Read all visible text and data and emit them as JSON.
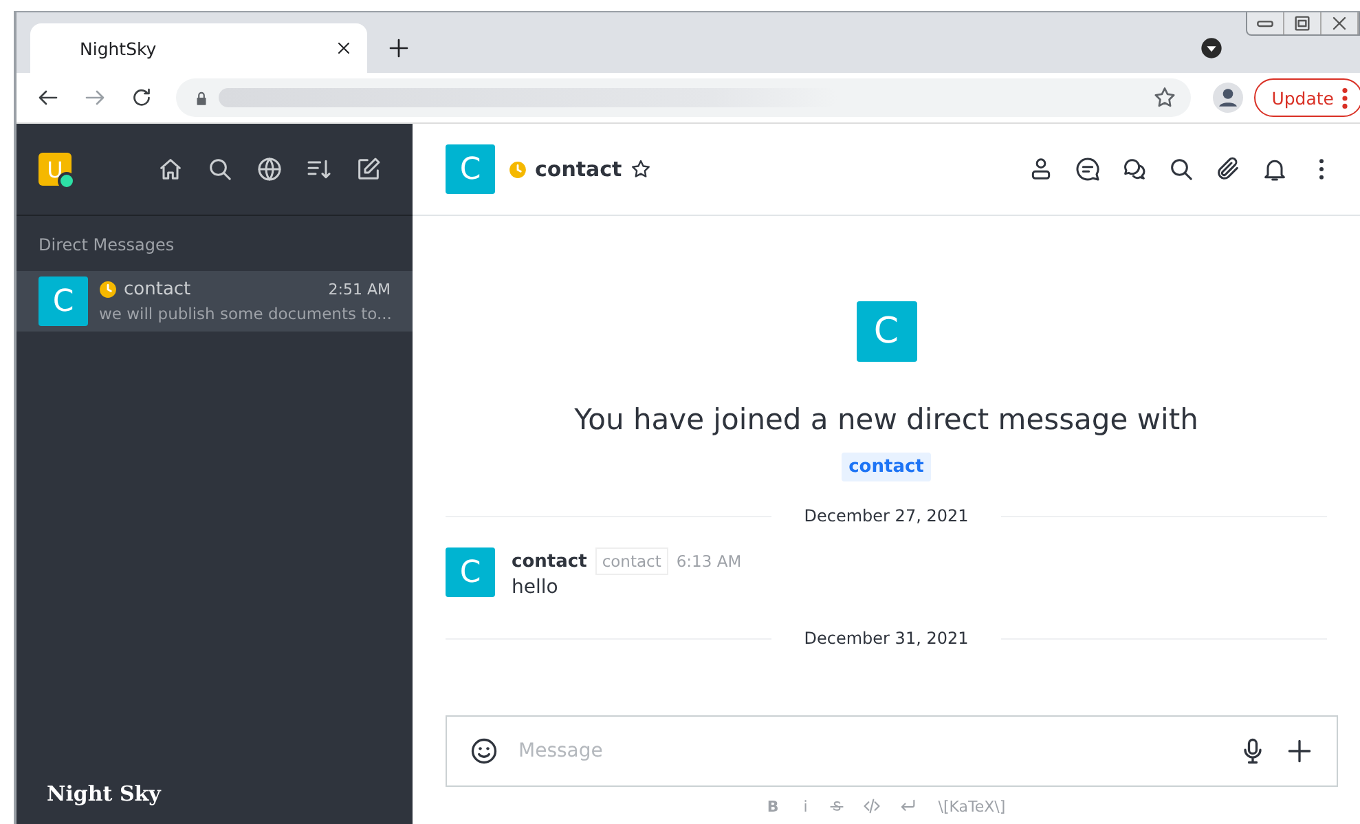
{
  "browser": {
    "tab": {
      "title": "NightSky",
      "selected": true
    },
    "update_button": "Update"
  },
  "sidebar": {
    "user_avatar": "U",
    "user_online": true,
    "section_title": "Direct Messages",
    "conversations": [
      {
        "avatar": "C",
        "color": "#f5b800",
        "name": "contact",
        "time": "2:51 AM",
        "preview": "we will publish some documents to...",
        "selected": true
      }
    ],
    "footer": "Night Sky"
  },
  "room": {
    "avatar": "C",
    "color": "#f5b800",
    "name": "contact",
    "favorite": false
  },
  "intro": {
    "avatar": "C",
    "text": "You have joined a new direct message with",
    "mention": "contact"
  },
  "messages": [
    {
      "kind": "divider",
      "date": "December 27, 2021"
    },
    {
      "kind": "message",
      "avatar": "C",
      "author": "contact",
      "tag": "contact",
      "time": "6:13 AM",
      "text": "hello"
    },
    {
      "kind": "divider",
      "date": "December 31, 2021"
    }
  ],
  "composer": {
    "placeholder": "Message",
    "bold": "B",
    "italic": "i",
    "katex": "\\[KaTeX\\]"
  }
}
